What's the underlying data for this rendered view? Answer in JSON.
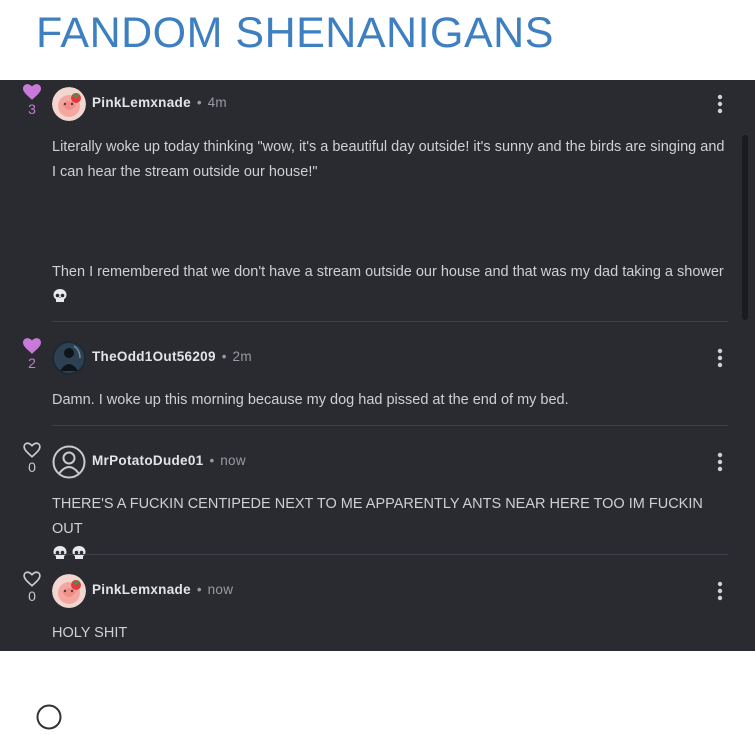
{
  "site": {
    "title": "FANDOM SHENANIGANS"
  },
  "colors": {
    "accent": "#3d7fc1",
    "liked": "#c879d9",
    "panel": "#2a2b30"
  },
  "comments": [
    {
      "likes": "3",
      "liked": true,
      "username": "PinkLemxnade",
      "time": "4m",
      "paragraphs": [
        "Literally woke up today thinking \"wow, it's a beautiful day outside! it's sunny and the birds are singing and I can hear the stream outside our house!\"",
        "Then I remembered that we don't have a stream outside our house and that was my dad taking a shower"
      ],
      "avatar_icon": "strawberry-avatar"
    },
    {
      "likes": "2",
      "liked": true,
      "username": "TheOdd1Out56209",
      "time": "2m",
      "paragraphs": [
        "Damn. I woke up this morning because my dog had pissed at the end of my bed."
      ],
      "avatar_icon": "dark-figure-avatar"
    },
    {
      "likes": "0",
      "liked": false,
      "username": "MrPotatoDude01",
      "time": "now",
      "paragraphs": [
        "THERE'S A FUCKIN CENTIPEDE NEXT TO ME APPARENTLY ANTS NEAR HERE TOO IM FUCKIN OUT"
      ],
      "avatar_icon": "default-user-avatar"
    },
    {
      "likes": "0",
      "liked": false,
      "username": "PinkLemxnade",
      "time": "now",
      "paragraphs": [
        "HOLY SHIT"
      ],
      "avatar_icon": "strawberry-avatar"
    }
  ],
  "separator": "•"
}
